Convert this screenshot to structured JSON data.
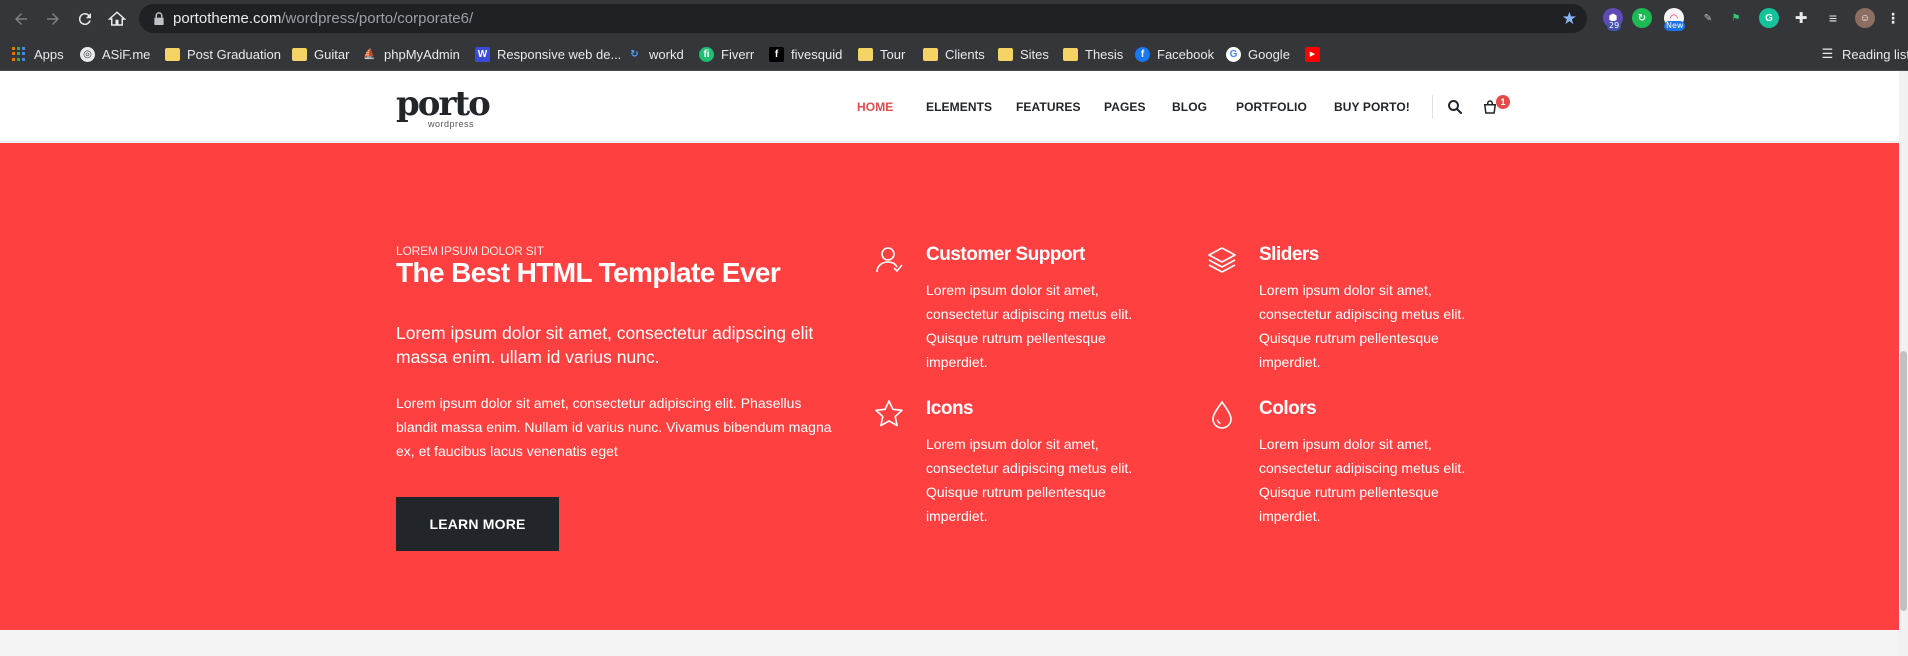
{
  "browser": {
    "url_host": "portotheme.com",
    "url_path": "/wordpress/porto/corporate6/",
    "extension_badges": {
      "ext1": "29",
      "ext3": "New"
    },
    "bookmarks": [
      {
        "label": "Apps",
        "icon": "apps-grid-icon"
      },
      {
        "label": "ASiF.me",
        "icon": "globe-icon"
      },
      {
        "label": "Post Graduation",
        "icon": "folder-icon"
      },
      {
        "label": "Guitar",
        "icon": "folder-icon"
      },
      {
        "label": "phpMyAdmin",
        "icon": "phpmyadmin-icon"
      },
      {
        "label": "Responsive web de...",
        "icon": "w-icon"
      },
      {
        "label": "workd",
        "icon": "workd-icon"
      },
      {
        "label": "Fiverr",
        "icon": "fiverr-icon"
      },
      {
        "label": "fivesquid",
        "icon": "fivesquid-icon"
      },
      {
        "label": "Tour",
        "icon": "folder-icon"
      },
      {
        "label": "Clients",
        "icon": "folder-icon"
      },
      {
        "label": "Sites",
        "icon": "folder-icon"
      },
      {
        "label": "Thesis",
        "icon": "folder-icon"
      },
      {
        "label": "Facebook",
        "icon": "facebook-icon"
      },
      {
        "label": "Google",
        "icon": "google-icon"
      },
      {
        "label": "",
        "icon": "youtube-icon"
      }
    ],
    "reading_list": "Reading list"
  },
  "site": {
    "logo_text": "porto",
    "logo_sub": "wordpress",
    "nav": [
      "HOME",
      "ELEMENTS",
      "FEATURES",
      "PAGES",
      "BLOG",
      "PORTFOLIO",
      "BUY PORTO!"
    ],
    "active_nav": "HOME",
    "cart_count": "1"
  },
  "hero": {
    "eyebrow": "LOREM IPSUM DOLOR SIT",
    "title": "The Best HTML Template Ever",
    "lead": "Lorem ipsum dolor sit amet, consectetur adipscing elit massa enim. ullam id varius nunc.",
    "body": "Lorem ipsum dolor sit amet, consectetur adipiscing elit. Phasellus blandit massa enim. Nullam id varius nunc. Vivamus bibendum magna ex, et faucibus lacus venenatis eget",
    "button": "LEARN MORE",
    "features": [
      {
        "title": "Customer Support",
        "icon": "user-support-icon",
        "text": "Lorem ipsum dolor sit amet, consectetur adipiscing metus elit. Quisque rutrum pellentesque imperdiet."
      },
      {
        "title": "Sliders",
        "icon": "layers-icon",
        "text": "Lorem ipsum dolor sit amet, consectetur adipiscing metus elit. Quisque rutrum pellentesque imperdiet."
      },
      {
        "title": "Icons",
        "icon": "star-icon",
        "text": "Lorem ipsum dolor sit amet, consectetur adipiscing metus elit. Quisque rutrum pellentesque imperdiet."
      },
      {
        "title": "Colors",
        "icon": "drop-icon",
        "text": "Lorem ipsum dolor sit amet, consectetur adipiscing metus elit. Quisque rutrum pellentesque imperdiet."
      }
    ]
  },
  "colors": {
    "hero_bg": "#ff4040",
    "accent": "#e44a4a",
    "dark": "#222529",
    "chrome": "#35363a"
  }
}
